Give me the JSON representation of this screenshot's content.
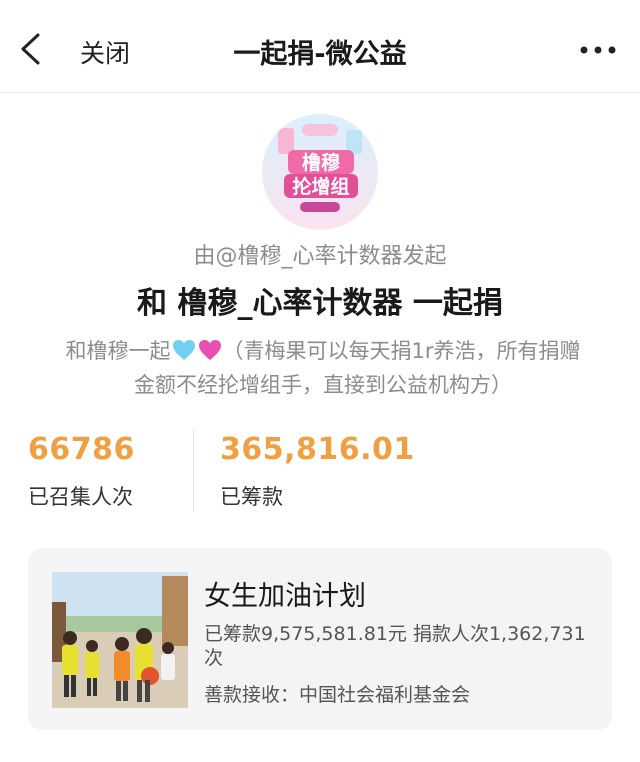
{
  "nav": {
    "close_label": "关闭",
    "title": "一起捐-微公益"
  },
  "avatar": {
    "text_line1": "橹穆",
    "text_line2": "抡增组"
  },
  "initiator": "由@橹穆_心率计数器发起",
  "headline": "和 橹穆_心率计数器 一起捐",
  "description": {
    "prefix": "和橹穆一起",
    "heart_blue_color": "#6fd0f0",
    "heart_pink_color": "#e84fb0",
    "suffix": "（青梅果可以每天捐1r养浩，所有捐赠金额不经抡增组手，直接到公益机构方）"
  },
  "stats": {
    "people": {
      "value": "66786",
      "label": "已召集人次"
    },
    "amount": {
      "value": "365,816.01",
      "label": "已筹款"
    }
  },
  "project": {
    "title": "女生加油计划",
    "raised": "已筹款9,575,581.81元",
    "donors": "捐款人次1,362,731次",
    "receiver": "善款接收：中国社会福利基金会"
  },
  "colors": {
    "accent": "#f0a040",
    "secondary_text": "#8c8c8c",
    "card_bg": "#f4f4f6"
  }
}
